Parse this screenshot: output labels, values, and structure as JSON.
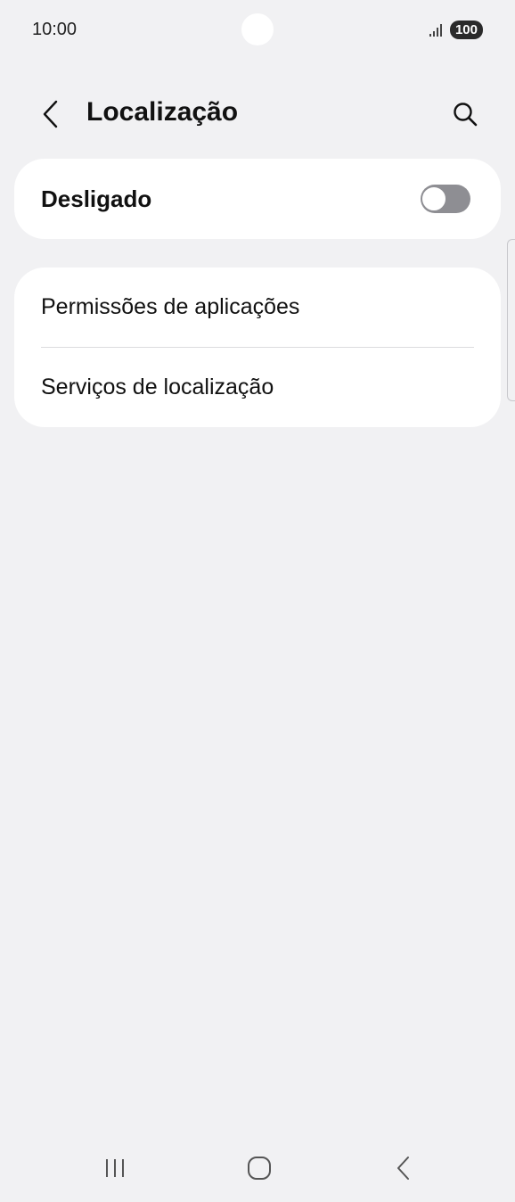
{
  "status_bar": {
    "time": "10:00",
    "battery": "100"
  },
  "header": {
    "title": "Localização",
    "back_icon": "chevron-left-icon",
    "search_icon": "search-icon"
  },
  "location_toggle": {
    "label": "Desligado",
    "enabled": false,
    "color_off": "#8e8e93"
  },
  "settings_list": {
    "items": [
      {
        "label": "Permissões de aplicações"
      },
      {
        "label": "Serviços de localização"
      }
    ]
  },
  "nav_bar": {
    "recents_icon": "recents-icon",
    "home_icon": "home-icon",
    "back_icon": "back-icon"
  },
  "colors": {
    "background": "#f1f1f3",
    "card": "#ffffff",
    "text": "#111111"
  }
}
